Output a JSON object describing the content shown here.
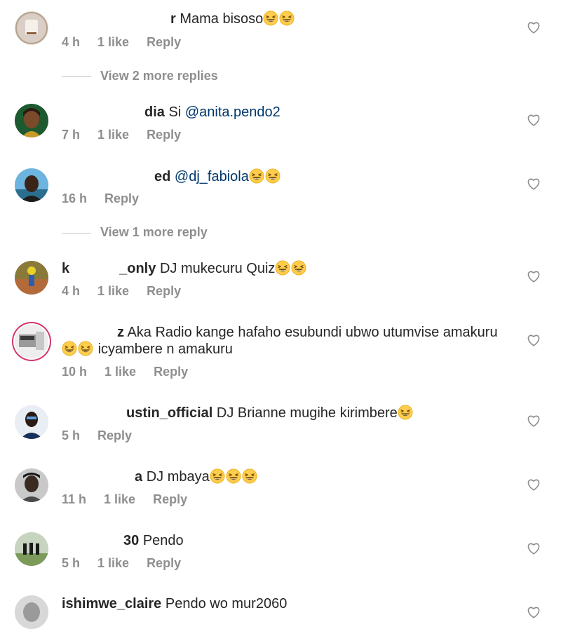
{
  "comments": [
    {
      "username": "r",
      "text": "Mama bisoso",
      "emojis": 2,
      "time": "4 h",
      "likes": "1 like",
      "reply": "Reply"
    },
    {
      "username": "dia",
      "text": "Si",
      "mention": "@anita.pendo2",
      "time": "7 h",
      "likes": "1 like",
      "reply": "Reply"
    },
    {
      "username": "ed",
      "mention": "@dj_fabiola",
      "emojis": 2,
      "time": "16 h",
      "reply": "Reply"
    },
    {
      "username_prefix": "k",
      "username": "_only",
      "text": "DJ mukecuru Quiz",
      "emojis": 2,
      "time": "4 h",
      "likes": "1 like",
      "reply": "Reply"
    },
    {
      "username": "z",
      "text": "Aka Radio kange hafaho esubundi ubwo utumvise amakuru",
      "text2": "icyambere n amakuru",
      "emojis": 2,
      "time": "10 h",
      "likes": "1 like",
      "reply": "Reply"
    },
    {
      "username": "ustin_official",
      "text": "DJ Brianne mugihe kirimbere",
      "emojis": 1,
      "time": "5 h",
      "reply": "Reply"
    },
    {
      "username": "a",
      "text": "DJ mbaya",
      "emojis": 3,
      "time": "11 h",
      "likes": "1 like",
      "reply": "Reply"
    },
    {
      "username": "30",
      "text": "Pendo",
      "time": "5 h",
      "likes": "1 like",
      "reply": "Reply"
    },
    {
      "username": "ishimwe_claire",
      "text": "Pendo wo mur2060"
    }
  ],
  "view_more": [
    "View 2 more replies",
    "View 1 more reply"
  ],
  "icons": {
    "like": "heart-outline-icon",
    "emoji": "grinning-squinting-face-emoji"
  },
  "colors": {
    "meta": "#8e8e8e",
    "mention": "#00376b",
    "text": "#262626",
    "story_ring": "#d6356b"
  }
}
